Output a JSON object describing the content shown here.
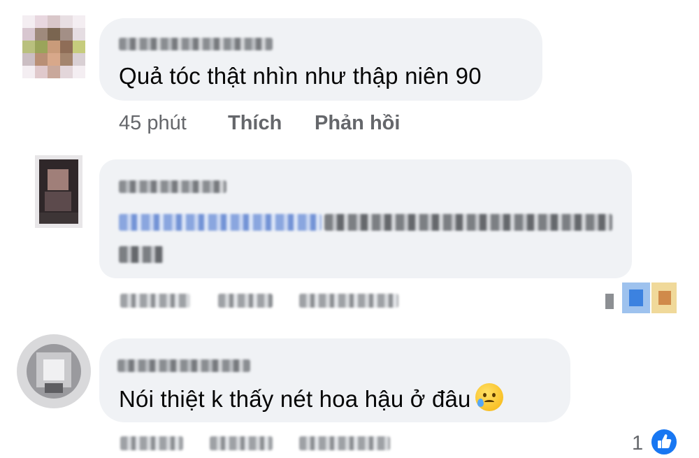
{
  "comments": [
    {
      "text": "Quả tóc thật nhìn như thập niên 90",
      "time": "45 phút",
      "like_label": "Thích",
      "reply_label": "Phản hồi"
    },
    {},
    {
      "text": "Nói thiệt k thấy nét hoa hậu ở đâu",
      "emoji_icon": "crying-face-icon",
      "reaction_count": "1",
      "reaction_icon": "like-reaction-icon"
    }
  ],
  "colors": {
    "bubble": "#f0f2f5",
    "text": "#050505",
    "muted": "#65676b",
    "like_blue": "#1877f2"
  }
}
